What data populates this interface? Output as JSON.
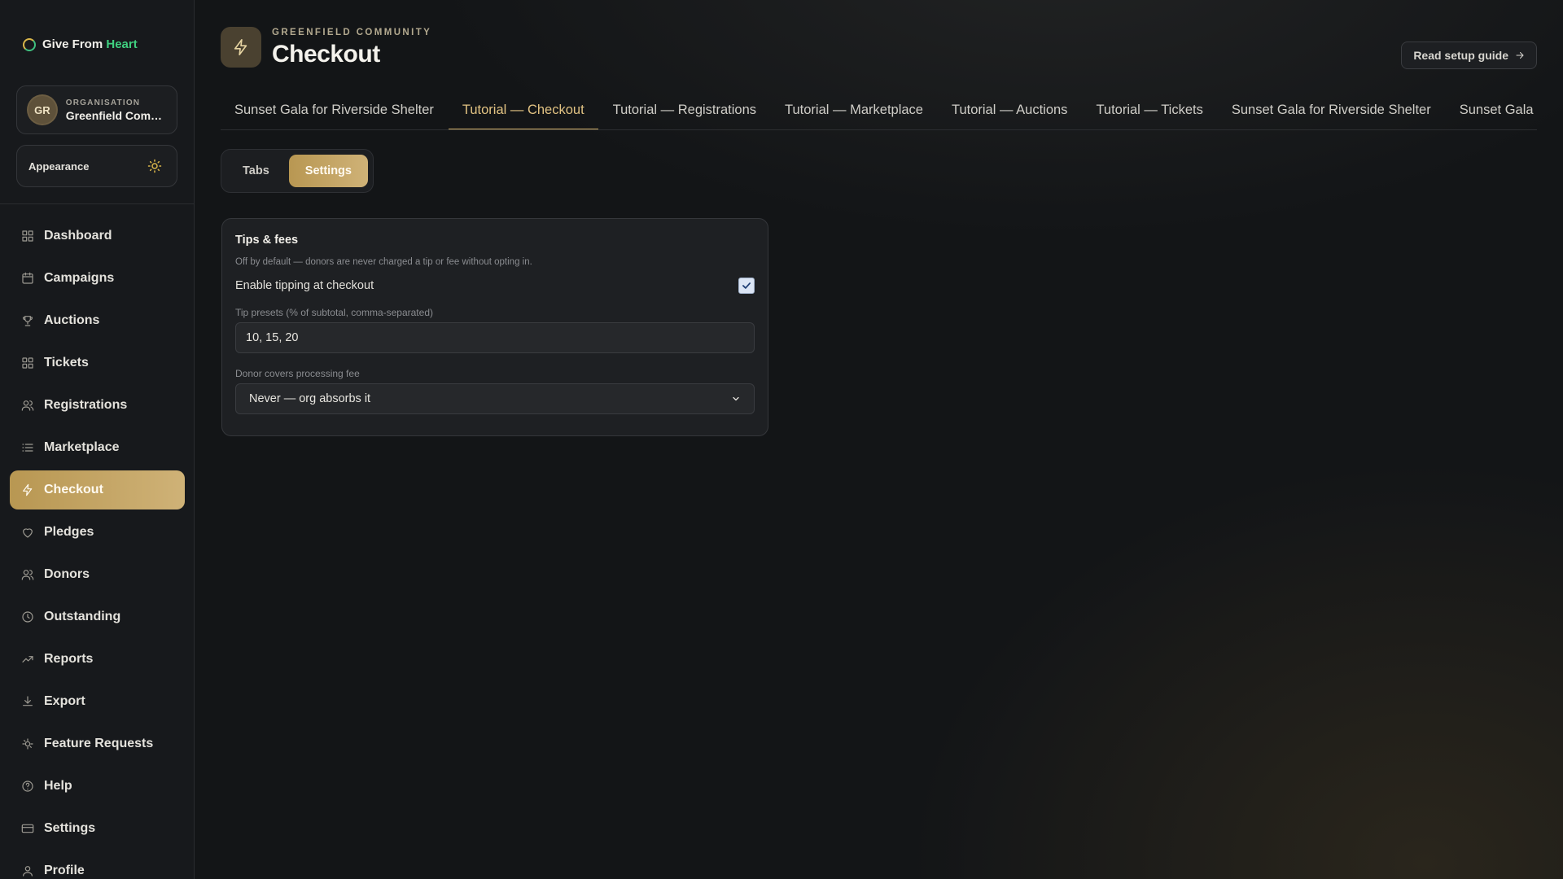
{
  "brand": {
    "name_part1": "Give From ",
    "name_part2": "Heart",
    "accent_color": "#3fcf7f"
  },
  "org": {
    "initials": "GR",
    "caption": "ORGANISATION",
    "name": "Greenfield Community"
  },
  "appearance": {
    "label": "Appearance",
    "icon": "sun-icon"
  },
  "nav": {
    "items": [
      {
        "label": "Dashboard",
        "icon": "dashboard-icon"
      },
      {
        "label": "Campaigns",
        "icon": "calendar-icon"
      },
      {
        "label": "Auctions",
        "icon": "trophy-icon"
      },
      {
        "label": "Tickets",
        "icon": "tickets-icon"
      },
      {
        "label": "Registrations",
        "icon": "users-icon"
      },
      {
        "label": "Marketplace",
        "icon": "list-icon"
      },
      {
        "label": "Checkout",
        "icon": "bolt-icon",
        "active": true
      },
      {
        "label": "Pledges",
        "icon": "heart-icon"
      },
      {
        "label": "Donors",
        "icon": "users-icon"
      },
      {
        "label": "Outstanding",
        "icon": "clock-icon"
      },
      {
        "label": "Reports",
        "icon": "trend-icon"
      },
      {
        "label": "Export",
        "icon": "download-icon"
      },
      {
        "label": "Feature Requests",
        "icon": "bug-icon"
      },
      {
        "label": "Help",
        "icon": "help-icon"
      },
      {
        "label": "Settings",
        "icon": "card-icon"
      },
      {
        "label": "Profile",
        "icon": "user-icon"
      }
    ]
  },
  "header": {
    "eyebrow": "GREENFIELD COMMUNITY",
    "title": "Checkout",
    "guide_label": "Read setup guide"
  },
  "tabs": [
    {
      "label": "Sunset Gala for Riverside Shelter"
    },
    {
      "label": "Tutorial — Checkout",
      "active": true
    },
    {
      "label": "Tutorial — Registrations"
    },
    {
      "label": "Tutorial — Marketplace"
    },
    {
      "label": "Tutorial — Auctions"
    },
    {
      "label": "Tutorial — Tickets"
    },
    {
      "label": "Sunset Gala for Riverside Shelter"
    },
    {
      "label": "Sunset Gala for Riverside Shelter"
    }
  ],
  "view_toggle": {
    "tabs_label": "Tabs",
    "settings_label": "Settings",
    "selected": "Settings"
  },
  "tips_card": {
    "title": "Tips & fees",
    "help": "Off by default — donors are never charged a tip or fee without opting in.",
    "enable_label": "Enable tipping at checkout",
    "enable_checked": true,
    "presets_label": "Tip presets (% of subtotal, comma-separated)",
    "presets_value": "10, 15, 20",
    "fee_label": "Donor covers processing fee",
    "fee_value": "Never — org absorbs it"
  },
  "colors": {
    "accent_gold": "#c9a968",
    "background": "#131517",
    "sidebar": "#17191c"
  }
}
